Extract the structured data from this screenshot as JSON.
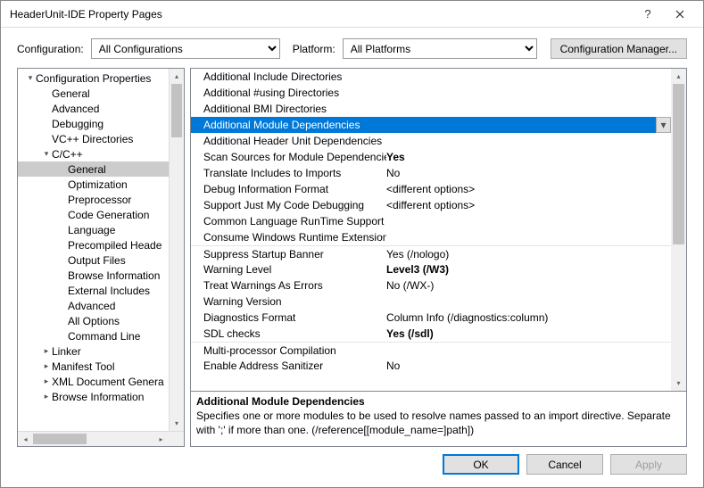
{
  "window": {
    "title": "HeaderUnit-IDE Property Pages"
  },
  "toolbar": {
    "config_label": "Configuration:",
    "config_value": "All Configurations",
    "platform_label": "Platform:",
    "platform_value": "All Platforms",
    "config_manager": "Configuration Manager..."
  },
  "tree": [
    {
      "label": "Configuration Properties",
      "depth": 0,
      "arrow": "▾"
    },
    {
      "label": "General",
      "depth": 1,
      "arrow": ""
    },
    {
      "label": "Advanced",
      "depth": 1,
      "arrow": ""
    },
    {
      "label": "Debugging",
      "depth": 1,
      "arrow": ""
    },
    {
      "label": "VC++ Directories",
      "depth": 1,
      "arrow": ""
    },
    {
      "label": "C/C++",
      "depth": 1,
      "arrow": "▾"
    },
    {
      "label": "General",
      "depth": 2,
      "arrow": "",
      "sel": true
    },
    {
      "label": "Optimization",
      "depth": 2,
      "arrow": ""
    },
    {
      "label": "Preprocessor",
      "depth": 2,
      "arrow": ""
    },
    {
      "label": "Code Generation",
      "depth": 2,
      "arrow": ""
    },
    {
      "label": "Language",
      "depth": 2,
      "arrow": ""
    },
    {
      "label": "Precompiled Heade",
      "depth": 2,
      "arrow": ""
    },
    {
      "label": "Output Files",
      "depth": 2,
      "arrow": ""
    },
    {
      "label": "Browse Information",
      "depth": 2,
      "arrow": ""
    },
    {
      "label": "External Includes",
      "depth": 2,
      "arrow": ""
    },
    {
      "label": "Advanced",
      "depth": 2,
      "arrow": ""
    },
    {
      "label": "All Options",
      "depth": 2,
      "arrow": ""
    },
    {
      "label": "Command Line",
      "depth": 2,
      "arrow": ""
    },
    {
      "label": "Linker",
      "depth": 1,
      "arrow": "▸"
    },
    {
      "label": "Manifest Tool",
      "depth": 1,
      "arrow": "▸"
    },
    {
      "label": "XML Document Genera",
      "depth": 1,
      "arrow": "▸"
    },
    {
      "label": "Browse Information",
      "depth": 1,
      "arrow": "▸"
    }
  ],
  "grid": [
    {
      "name": "Additional Include Directories",
      "value": "",
      "sel": false,
      "bt": false
    },
    {
      "name": "Additional #using Directories",
      "value": "",
      "sel": false,
      "bt": false
    },
    {
      "name": "Additional BMI Directories",
      "value": "",
      "sel": false,
      "bt": false
    },
    {
      "name": "Additional Module Dependencies",
      "value": "",
      "sel": true,
      "bt": false,
      "dd": true
    },
    {
      "name": "Additional Header Unit Dependencies",
      "value": "",
      "sel": false,
      "bt": false
    },
    {
      "name": "Scan Sources for Module Dependencies",
      "value": "Yes",
      "bold": true,
      "sel": false,
      "bt": false
    },
    {
      "name": "Translate Includes to Imports",
      "value": "No",
      "sel": false,
      "bt": false
    },
    {
      "name": "Debug Information Format",
      "value": "<different options>",
      "sel": false,
      "bt": false
    },
    {
      "name": "Support Just My Code Debugging",
      "value": "<different options>",
      "sel": false,
      "bt": false
    },
    {
      "name": "Common Language RunTime Support",
      "value": "",
      "sel": false,
      "bt": false
    },
    {
      "name": "Consume Windows Runtime Extension",
      "value": "",
      "sel": false,
      "bt": false
    },
    {
      "name": "Suppress Startup Banner",
      "value": "Yes (/nologo)",
      "sel": false,
      "bt": true
    },
    {
      "name": "Warning Level",
      "value": "Level3 (/W3)",
      "bold": true,
      "sel": false,
      "bt": false
    },
    {
      "name": "Treat Warnings As Errors",
      "value": "No (/WX-)",
      "sel": false,
      "bt": false
    },
    {
      "name": "Warning Version",
      "value": "",
      "sel": false,
      "bt": false
    },
    {
      "name": "Diagnostics Format",
      "value": "Column Info (/diagnostics:column)",
      "sel": false,
      "bt": false
    },
    {
      "name": "SDL checks",
      "value": "Yes (/sdl)",
      "bold": true,
      "sel": false,
      "bt": false
    },
    {
      "name": "Multi-processor Compilation",
      "value": "",
      "sel": false,
      "bt": true
    },
    {
      "name": "Enable Address Sanitizer",
      "value": "No",
      "sel": false,
      "bt": false
    }
  ],
  "description": {
    "title": "Additional Module Dependencies",
    "text": "Specifies one or more modules to be used to resolve names passed to an import directive. Separate with ';' if more than one.  (/reference[[module_name=]path])"
  },
  "footer": {
    "ok": "OK",
    "cancel": "Cancel",
    "apply": "Apply"
  }
}
